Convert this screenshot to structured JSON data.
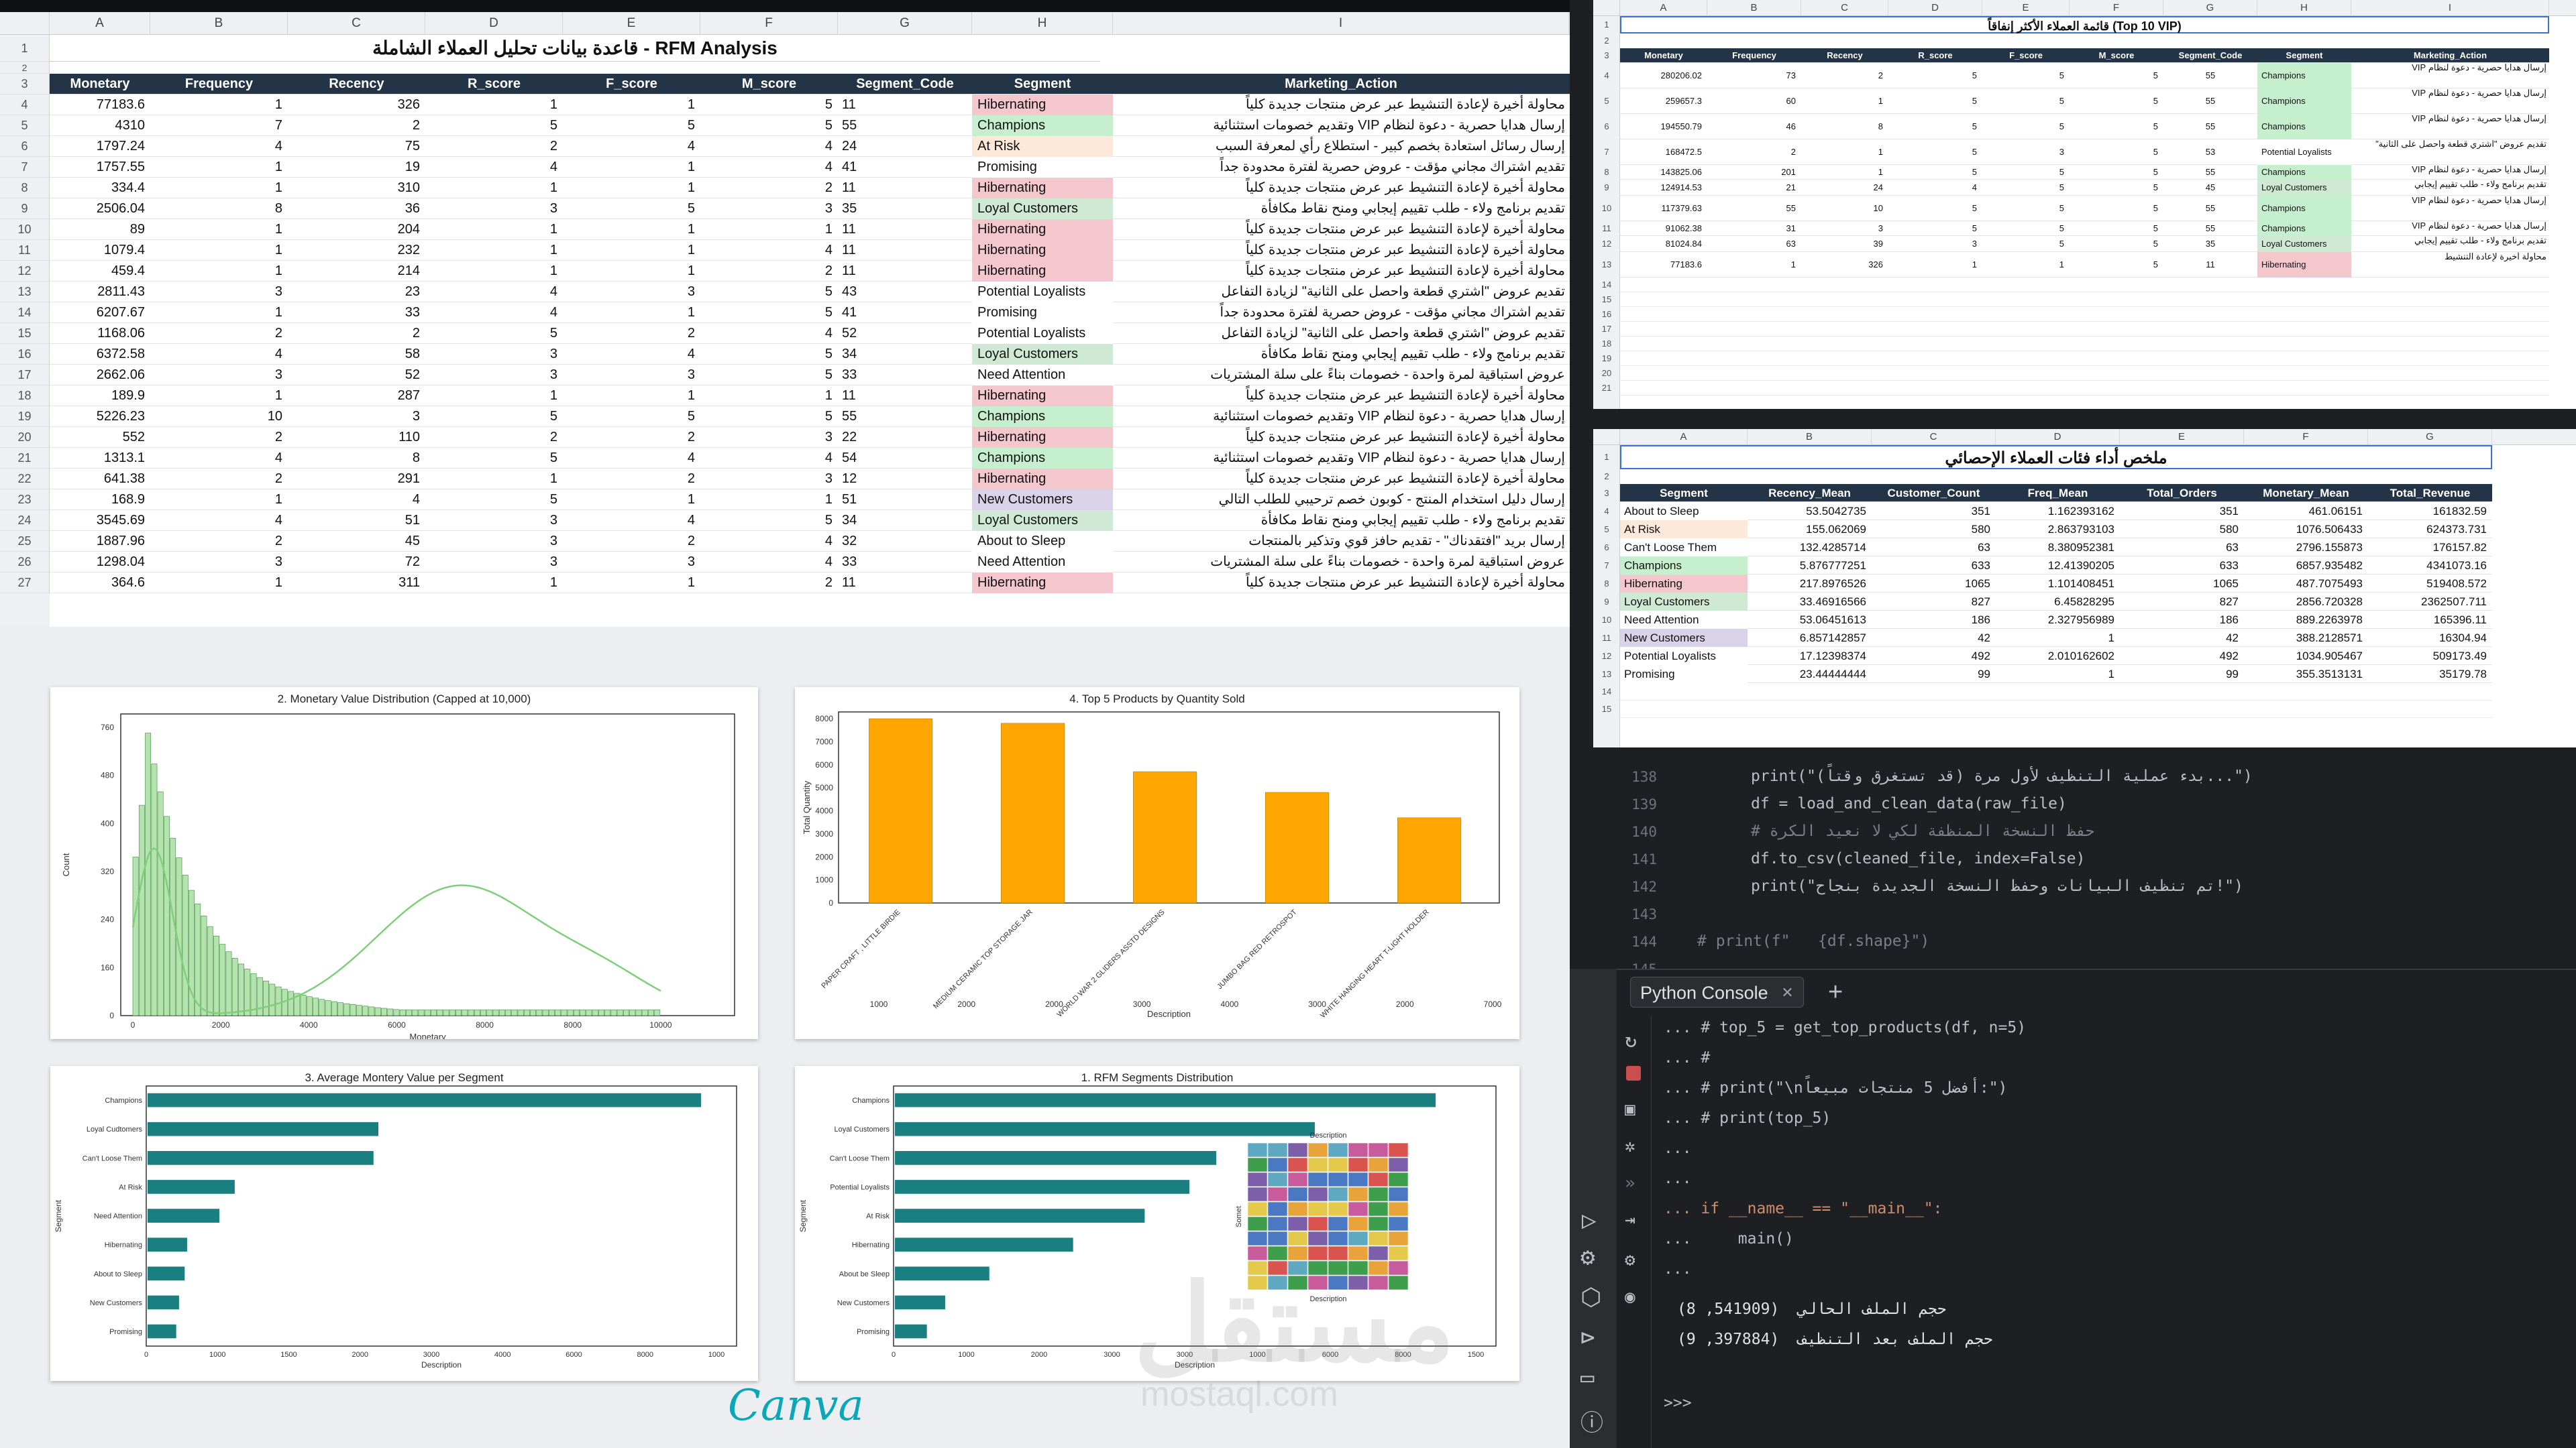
{
  "main_sheet": {
    "columns": [
      "A",
      "B",
      "C",
      "D",
      "E",
      "F",
      "G",
      "H",
      "I"
    ],
    "title": "قاعدة بيانات تحليل العملاء الشاملة - RFM Analysis",
    "headers": [
      "Monetary",
      "Frequency",
      "Recency",
      "R_score",
      "F_score",
      "M_score",
      "Segment_Code",
      "Segment",
      "Marketing_Action"
    ],
    "rows": [
      [
        "77183.6",
        "1",
        "326",
        "1",
        "1",
        "5",
        "11",
        "Hibernating",
        "محاولة أخيرة لإعادة التنشيط عبر عرض منتجات جديدة كلياً"
      ],
      [
        "4310",
        "7",
        "2",
        "5",
        "5",
        "5",
        "55",
        "Champions",
        "إرسال هدايا حصرية - دعوة لنظام VIP وتقديم خصومات استثنائية"
      ],
      [
        "1797.24",
        "4",
        "75",
        "2",
        "4",
        "4",
        "24",
        "At Risk",
        "إرسال رسائل استعادة بخصم كبير - استطلاع رأي لمعرفة السبب"
      ],
      [
        "1757.55",
        "1",
        "19",
        "4",
        "1",
        "4",
        "41",
        "Promising",
        "تقديم اشتراك مجاني مؤقت - عروض حصرية لفترة محدودة جداً"
      ],
      [
        "334.4",
        "1",
        "310",
        "1",
        "1",
        "2",
        "11",
        "Hibernating",
        "محاولة أخيرة لإعادة التنشيط عبر عرض منتجات جديدة كلياً"
      ],
      [
        "2506.04",
        "8",
        "36",
        "3",
        "5",
        "3",
        "35",
        "Loyal Customers",
        "تقديم برنامج ولاء - طلب تقييم إيجابي ومنح نقاط مكافأة"
      ],
      [
        "89",
        "1",
        "204",
        "1",
        "1",
        "1",
        "11",
        "Hibernating",
        "محاولة أخيرة لإعادة التنشيط عبر عرض منتجات جديدة كلياً"
      ],
      [
        "1079.4",
        "1",
        "232",
        "1",
        "1",
        "4",
        "11",
        "Hibernating",
        "محاولة أخيرة لإعادة التنشيط عبر عرض منتجات جديدة كلياً"
      ],
      [
        "459.4",
        "1",
        "214",
        "1",
        "1",
        "2",
        "11",
        "Hibernating",
        "محاولة أخيرة لإعادة التنشيط عبر عرض منتجات جديدة كلياً"
      ],
      [
        "2811.43",
        "3",
        "23",
        "4",
        "3",
        "5",
        "43",
        "Potential Loyalists",
        "تقديم عروض \"اشتري قطعة واحصل على الثانية\" لزيادة التفاعل"
      ],
      [
        "6207.67",
        "1",
        "33",
        "4",
        "1",
        "5",
        "41",
        "Promising",
        "تقديم اشتراك مجاني مؤقت - عروض حصرية لفترة محدودة جداً"
      ],
      [
        "1168.06",
        "2",
        "2",
        "5",
        "2",
        "4",
        "52",
        "Potential Loyalists",
        "تقديم عروض \"اشتري قطعة واحصل على الثانية\" لزيادة التفاعل"
      ],
      [
        "6372.58",
        "4",
        "58",
        "3",
        "4",
        "5",
        "34",
        "Loyal Customers",
        "تقديم برنامج ولاء - طلب تقييم إيجابي ومنح نقاط مكافأة"
      ],
      [
        "2662.06",
        "3",
        "52",
        "3",
        "3",
        "5",
        "33",
        "Need Attention",
        "عروض استباقية لمرة واحدة - خصومات بناءً على سلة المشتريات"
      ],
      [
        "189.9",
        "1",
        "287",
        "1",
        "1",
        "1",
        "11",
        "Hibernating",
        "محاولة أخيرة لإعادة التنشيط عبر عرض منتجات جديدة كلياً"
      ],
      [
        "5226.23",
        "10",
        "3",
        "5",
        "5",
        "5",
        "55",
        "Champions",
        "إرسال هدايا حصرية - دعوة لنظام VIP وتقديم خصومات استثنائية"
      ],
      [
        "552",
        "2",
        "110",
        "2",
        "2",
        "3",
        "22",
        "Hibernating",
        "محاولة أخيرة لإعادة التنشيط عبر عرض منتجات جديدة كلياً"
      ],
      [
        "1313.1",
        "4",
        "8",
        "5",
        "4",
        "4",
        "54",
        "Champions",
        "إرسال هدايا حصرية - دعوة لنظام VIP وتقديم خصومات استثنائية"
      ],
      [
        "641.38",
        "2",
        "291",
        "1",
        "2",
        "3",
        "12",
        "Hibernating",
        "محاولة أخيرة لإعادة التنشيط عبر عرض منتجات جديدة كلياً"
      ],
      [
        "168.9",
        "1",
        "4",
        "5",
        "1",
        "1",
        "51",
        "New Customers",
        "إرسال دليل استخدام المنتج - كوبون خصم ترحيبي للطلب التالي"
      ],
      [
        "3545.69",
        "4",
        "51",
        "3",
        "4",
        "5",
        "34",
        "Loyal Customers",
        "تقديم برنامج ولاء - طلب تقييم إيجابي ومنح نقاط مكافأة"
      ],
      [
        "1887.96",
        "2",
        "45",
        "3",
        "2",
        "4",
        "32",
        "About to Sleep",
        "إرسال بريد \"افتقدناك\" - تقديم حافز قوي وتذكير بالمنتجات"
      ],
      [
        "1298.04",
        "3",
        "72",
        "3",
        "3",
        "4",
        "33",
        "Need Attention",
        "عروض استباقية لمرة واحدة - خصومات بناءً على سلة المشتريات"
      ],
      [
        "364.6",
        "1",
        "311",
        "1",
        "1",
        "2",
        "11",
        "Hibernating",
        "محاولة أخيرة لإعادة التنشيط عبر عرض منتجات جديدة كلياً"
      ]
    ]
  },
  "top_sheet": {
    "columns": [
      "A",
      "B",
      "C",
      "D",
      "E",
      "F",
      "G",
      "H",
      "I"
    ],
    "title": "قائمة العملاء الأكثر إنفاقاً (Top 10 VIP)",
    "headers": [
      "Monetary",
      "Frequency",
      "Recency",
      "R_score",
      "F_score",
      "M_score",
      "Segment_Code",
      "Segment",
      "Marketing_Action"
    ],
    "rows": [
      [
        "280206.02",
        "73",
        "2",
        "5",
        "5",
        "5",
        "55",
        "Champions",
        "إرسال هدايا حصرية - دعوة لنظام VIP"
      ],
      [
        "259657.3",
        "60",
        "1",
        "5",
        "5",
        "5",
        "55",
        "Champions",
        "إرسال هدايا حصرية - دعوة لنظام VIP"
      ],
      [
        "194550.79",
        "46",
        "8",
        "5",
        "5",
        "5",
        "55",
        "Champions",
        "إرسال هدايا حصرية - دعوة لنظام VIP"
      ],
      [
        "168472.5",
        "2",
        "1",
        "5",
        "3",
        "5",
        "53",
        "Potential Loyalists",
        "تقديم عروض \"اشتري قطعة واحصل على الثانية\""
      ],
      [
        "143825.06",
        "201",
        "1",
        "5",
        "5",
        "5",
        "55",
        "Champions",
        "إرسال هدايا حصرية - دعوة لنظام VIP"
      ],
      [
        "124914.53",
        "21",
        "24",
        "4",
        "5",
        "5",
        "45",
        "Loyal Customers",
        "تقديم برنامج ولاء - طلب تقييم إيجابي"
      ],
      [
        "117379.63",
        "55",
        "10",
        "5",
        "5",
        "5",
        "55",
        "Champions",
        "إرسال هدايا حصرية - دعوة لنظام VIP"
      ],
      [
        "91062.38",
        "31",
        "3",
        "5",
        "5",
        "5",
        "55",
        "Champions",
        "إرسال هدايا حصرية - دعوة لنظام VIP"
      ],
      [
        "81024.84",
        "63",
        "39",
        "3",
        "5",
        "5",
        "35",
        "Loyal Customers",
        "تقديم برنامج ولاء - طلب تقييم إيجابي"
      ],
      [
        "77183.6",
        "1",
        "326",
        "1",
        "1",
        "5",
        "11",
        "Hibernating",
        "محاولة أخيرة لإعادة التنشيط"
      ]
    ]
  },
  "summary_sheet": {
    "columns": [
      "A",
      "B",
      "C",
      "D",
      "E",
      "F",
      "G"
    ],
    "title": "ملخص أداء فئات العملاء الإحصائي",
    "headers": [
      "Segment",
      "Recency_Mean",
      "Customer_Count",
      "Freq_Mean",
      "Total_Orders",
      "Monetary_Mean",
      "Total_Revenue"
    ],
    "rows": [
      [
        "About to Sleep",
        "53.5042735",
        "351",
        "1.162393162",
        "351",
        "461.06151",
        "161832.59"
      ],
      [
        "At Risk",
        "155.062069",
        "580",
        "2.863793103",
        "580",
        "1076.506433",
        "624373.731"
      ],
      [
        "Can't Loose Them",
        "132.4285714",
        "63",
        "8.380952381",
        "63",
        "2796.155873",
        "176157.82"
      ],
      [
        "Champions",
        "5.876777251",
        "633",
        "12.41390205",
        "633",
        "6857.935482",
        "4341073.16"
      ],
      [
        "Hibernating",
        "217.8976526",
        "1065",
        "1.101408451",
        "1065",
        "487.7075493",
        "519408.572"
      ],
      [
        "Loyal Customers",
        "33.46916566",
        "827",
        "6.45828295",
        "827",
        "2856.720328",
        "2362507.711"
      ],
      [
        "Need Attention",
        "53.06451613",
        "186",
        "2.327956989",
        "186",
        "889.2263978",
        "165396.11"
      ],
      [
        "New Customers",
        "6.857142857",
        "42",
        "1",
        "42",
        "388.2128571",
        "16304.94"
      ],
      [
        "Potential Loyalists",
        "17.12398374",
        "492",
        "2.010162602",
        "492",
        "1034.905467",
        "509173.49"
      ],
      [
        "Promising",
        "23.44444444",
        "99",
        "1",
        "99",
        "355.3513131",
        "35179.78"
      ]
    ]
  },
  "segment_colors": {
    "Hibernating": "#f4c7cf",
    "Champions": "#c6efce",
    "At Risk": "#fde9d9",
    "Loyal Customers": "#cfe9d4",
    "New Customers": "#d9d2e9",
    "Promising": "#ffffff",
    "Potential Loyalists": "#ffffff",
    "Need Attention": "#ffffff",
    "About to Sleep": "#ffffff",
    "Can't Loose Them": "#ffffff"
  },
  "charts": {
    "hist": {
      "title": "2. Monetary Value Distribution (Capped at 10,000)",
      "xlabel": "Monetary",
      "ylabel": "Count",
      "yticks": [
        "0",
        "160",
        "240",
        "320",
        "400",
        "480",
        "760"
      ],
      "xticks": [
        "0",
        "2000",
        "4000",
        "6000",
        "8000",
        "8000",
        "10000"
      ]
    },
    "top5": {
      "title": "4. Top 5 Products by Quantity Sold",
      "xlabel": "Description",
      "ylabel": "Total Quantity",
      "categories": [
        "PAPER CRAFT , LITTLE BIRDIE",
        "MEDIUM CERAMIC TOP STORAGE JAR",
        "WORLD WAR 2 GLIDERS ASSTD DESIGNS",
        "JUMBO BAG RED RETROSPOT",
        "WHITE HANGING HEART T-LIGHT HOLDER"
      ],
      "values": [
        8000,
        7800,
        5700,
        4800,
        3700
      ],
      "yticks": [
        "0",
        "1000",
        "2000",
        "3000",
        "4000",
        "5000",
        "6000",
        "7000",
        "8000"
      ],
      "xticks": [
        "1000",
        "2000",
        "2000",
        "3000",
        "4000",
        "3000",
        "2000",
        "7000"
      ]
    },
    "avg": {
      "title": "3. Average Montery Value per Segment",
      "xlabel": "Description",
      "ylabel": "Segment",
      "categories": [
        "Champions",
        "Loyal Cudtomers",
        "Can't Loose Them",
        "At Risk",
        "Need Attention",
        "Hibernating",
        "About to Sleep",
        "New Customers",
        "Promising"
      ],
      "values": [
        6860,
        2860,
        2800,
        1080,
        890,
        490,
        460,
        390,
        355
      ],
      "xticks": [
        "0",
        "1000",
        "1500",
        "2000",
        "3000",
        "4000",
        "6000",
        "8000",
        "1000"
      ]
    },
    "rfm": {
      "title": "1. RFM Segments Distribution",
      "xlabel": "Description",
      "ylabel": "Segment",
      "inset_title": "Description",
      "inset_xlabel": "Description",
      "inset_ylabel": "Somet",
      "categories": [
        "Champions",
        "Loyal Customers",
        "Can't Loose Them",
        "Potential Loyalists",
        "At Risk",
        "Hibernating",
        "About be Sleep",
        "New Customers",
        "Promising"
      ],
      "values": [
        1065,
        827,
        633,
        580,
        492,
        351,
        186,
        99,
        63
      ],
      "xticks": [
        "0",
        "1000",
        "2000",
        "3000",
        "3000",
        "1000",
        "6000",
        "8000",
        "1500"
      ]
    }
  },
  "brand": {
    "canva": "Canva",
    "watermark": "مستقل",
    "watermark_url": "mostaql.com"
  },
  "ide": {
    "lines": [
      {
        "n": "138",
        "t": "print(\"بدء عملية التنظيف لأول مرة (قد تستغرق وقتاً)...\")"
      },
      {
        "n": "139",
        "t": "df = load_and_clean_data(raw_file)"
      },
      {
        "n": "140",
        "t": "# حفظ النسخة المنظفة لكي لا نعيد الكرة"
      },
      {
        "n": "141",
        "t": "df.to_csv(cleaned_file, index=False)"
      },
      {
        "n": "142",
        "t": "print(\"تم تنظيف البيانات وحفظ النسخة الجديدة بنجاح!\")"
      },
      {
        "n": "143",
        "t": ""
      },
      {
        "n": "144",
        "t": "# print(f\"   {df.shape}\")"
      },
      {
        "n": "145",
        "t": ""
      }
    ],
    "console_tab": "Python Console",
    "console_lines": [
      "... # top_5 = get_top_products(df, n=5)",
      "... #",
      "... # print(\"\\nأفضل 5 منتجات مبيعاً:\")",
      "... # print(top_5)",
      "...",
      "...",
      "... if __name__ == \"__main__\":",
      "...     main()",
      "..."
    ],
    "output": [
      "(8 ,541909)  حجم الملف الحالي",
      "(9 ,397884)  حجم الملف بعد التنظيف"
    ],
    "prompt": ">>>"
  }
}
